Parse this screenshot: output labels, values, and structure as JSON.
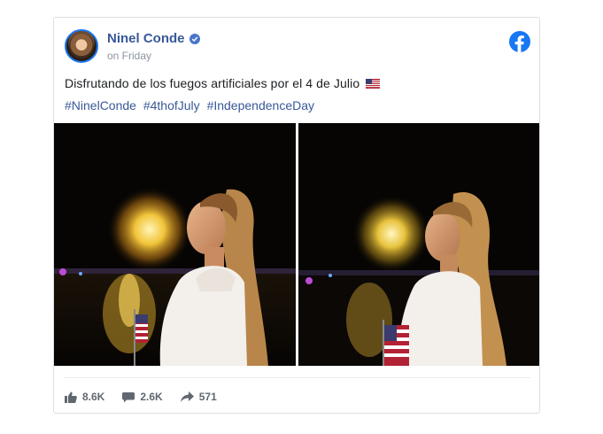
{
  "post": {
    "author": "Ninel Conde",
    "timestamp": "on Friday",
    "text": "Disfrutando de los fuegos artificiales por el 4 de Julio",
    "hashtags": [
      "#NinelConde",
      "#4thofJuly",
      "#IndependenceDay"
    ],
    "images": [
      {
        "alt": "Woman in white top with fireworks and US flag at night"
      },
      {
        "alt": "Woman in white top in profile with fireworks and US flag at night"
      }
    ]
  },
  "stats": {
    "likes": "8.6K",
    "comments": "2.6K",
    "shares": "571"
  },
  "colors": {
    "facebook_blue": "#1877f2",
    "link": "#385898",
    "text": "#1c1e21",
    "muted": "#8d949e"
  },
  "icons": [
    "verified-badge-icon",
    "facebook-logo-icon",
    "like-icon",
    "comment-icon",
    "share-icon",
    "us-flag-emoji-icon"
  ]
}
